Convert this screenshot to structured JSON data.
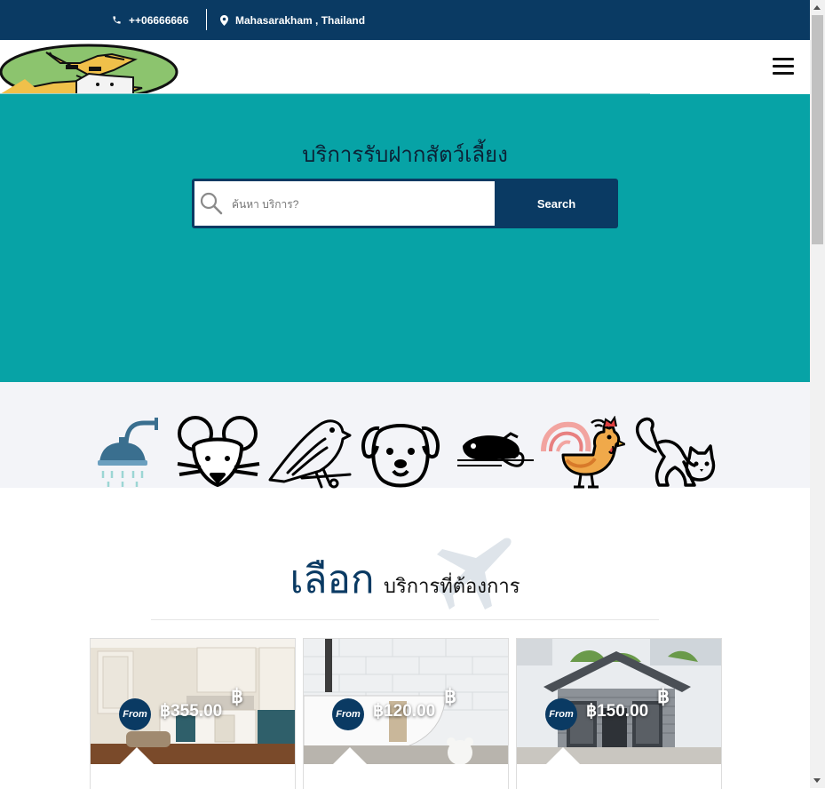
{
  "topbar": {
    "phone": "++06666666",
    "location": "Mahasarakham , Thailand"
  },
  "hero": {
    "title": "บริการรับฝากสัตว์เลี้ยง",
    "search_placeholder": "ค้นหา บริการ?",
    "search_button": "Search"
  },
  "categories": [
    {
      "icon": "shower-icon"
    },
    {
      "icon": "mouse-icon"
    },
    {
      "icon": "bird-icon"
    },
    {
      "icon": "dog-icon"
    },
    {
      "icon": "chameleon-icon"
    },
    {
      "icon": "rooster-icon"
    },
    {
      "icon": "cat-icon"
    }
  ],
  "section": {
    "title_big": "เลือก",
    "title_small": "บริการที่ต้องการ"
  },
  "cards": [
    {
      "from": "From",
      "price": "฿355.00",
      "currency": "฿"
    },
    {
      "from": "From",
      "price": "฿120.00",
      "currency": "฿"
    },
    {
      "from": "From",
      "price": "฿150.00",
      "currency": "฿"
    }
  ],
  "colors": {
    "navy": "#0a3a63",
    "teal": "#07a3a6",
    "strip": "#f3f4f8"
  }
}
